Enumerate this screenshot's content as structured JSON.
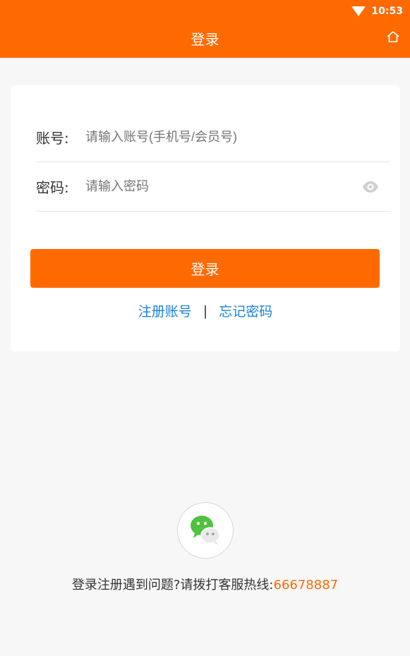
{
  "status_bar": {
    "time": "10:53",
    "wifi_icon": "wifi-icon"
  },
  "header": {
    "title": "登录",
    "home_icon": "home-icon"
  },
  "form": {
    "account_label": "账号:",
    "account_placeholder": "请输入账号(手机号/会员号)",
    "password_label": "密码:",
    "password_placeholder": "请输入密码",
    "eye_icon": "eye-icon"
  },
  "buttons": {
    "login": "登录"
  },
  "links": {
    "register": "注册账号",
    "separator": "|",
    "forgot": "忘记密码"
  },
  "help": {
    "text": "登录注册遇到问题?请拨打客服热线:",
    "phone": "66678887"
  },
  "colors": {
    "brand": "#ff6a00",
    "link": "#1a82d9",
    "background": "#f7f7f7"
  },
  "icons": {
    "wechat": "wechat-icon"
  }
}
